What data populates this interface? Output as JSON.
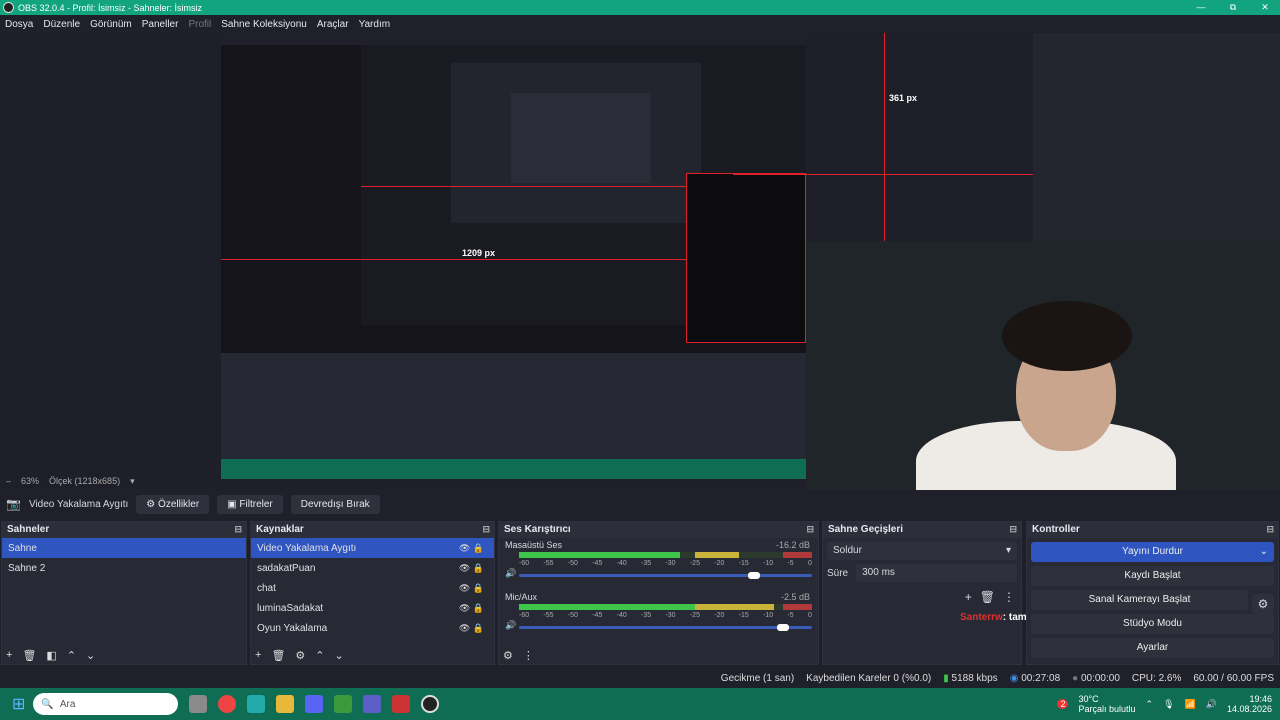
{
  "window": {
    "title": "OBS 32.0.4 - Profil: İsimsiz - Sahneler: İsimsiz",
    "min": "—",
    "max": "⧉",
    "close": "✕"
  },
  "menu": [
    "Dosya",
    "Düzenle",
    "Görünüm",
    "Paneller",
    "Profil",
    "Sahne Koleksiyonu",
    "Araçlar",
    "Yardım"
  ],
  "preview": {
    "zoom": "63%",
    "scale": "Ölçek (1218x685)",
    "px_label_v": "361 px",
    "px_label_h": "1209 px"
  },
  "source_toolbar": {
    "source": "Video Yakalama Aygıtı",
    "properties": "Özellikler",
    "filters": "Filtreler",
    "deactivate": "Devredışı Bırak"
  },
  "scenes": {
    "title": "Sahneler",
    "items": [
      "Sahne",
      "Sahne 2"
    ]
  },
  "sources": {
    "title": "Kaynaklar",
    "items": [
      "Video Yakalama Aygıtı",
      "sadakatPuan",
      "chat",
      "luminaSadakat",
      "Oyun Yakalama"
    ]
  },
  "mixer": {
    "title": "Ses Karıştırıcı",
    "scale": [
      "-60",
      "-55",
      "-50",
      "-45",
      "-40",
      "-35",
      "-30",
      "-25",
      "-20",
      "-15",
      "-10",
      "-5",
      "0"
    ],
    "channels": [
      {
        "name": "Masaüstü Ses",
        "db": "-16.2 dB",
        "level": 0.55,
        "volume": 0.78
      },
      {
        "name": "Mic/Aux",
        "db": "-2.5 dB",
        "level": 0.72,
        "volume": 0.88
      }
    ]
  },
  "transitions": {
    "title": "Sahne Geçişleri",
    "selected": "Soldur",
    "duration_label": "Süre",
    "duration": "300 ms"
  },
  "controls": {
    "title": "Kontroller",
    "stream": "Yayını Durdur",
    "record": "Kaydı Başlat",
    "virtualcam": "Sanal Kamerayı Başlat",
    "studio": "Stüdyo Modu",
    "settings": "Ayarlar"
  },
  "chat": {
    "user": "Santerrw",
    "message": ": tamam abi vurma"
  },
  "status": {
    "delay": "Gecikme (1 san)",
    "dropped": "Kaybedilen Kareler 0 (%0.0)",
    "bitrate": "5188 kbps",
    "stream_time": "00:27:08",
    "rec_time": "00:00:00",
    "cpu": "CPU: 2.6%",
    "fps": "60.00 / 60.00 FPS"
  },
  "taskbar": {
    "search": "Ara",
    "weather_temp": "30°C",
    "weather_desc": "Parçalı bulutlu",
    "time": "19:46",
    "date": "14.08.2026",
    "badge": "2"
  },
  "colors": {
    "accent": "#2e55c0",
    "taskbar": "#0e6d52",
    "titlebar": "#12a37f"
  }
}
